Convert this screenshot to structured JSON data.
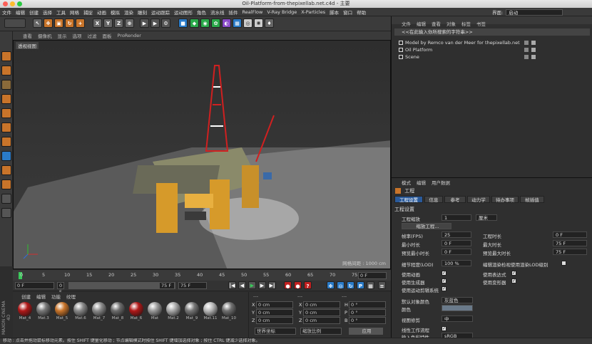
{
  "window": {
    "title": "Oil-Platform-from-thepixellab.net.c4d - 主要"
  },
  "menubar": {
    "items": [
      "文件",
      "编辑",
      "创建",
      "选择",
      "工具",
      "网格",
      "捕捉",
      "动画",
      "模拟",
      "渲染",
      "雕刻",
      "运动跟踪",
      "运动图形",
      "角色",
      "流水线",
      "插件",
      "RealFlow",
      "V-Ray Bridge",
      "X-Particles",
      "脚本",
      "窗口",
      "帮助"
    ],
    "layout_label": "界面:",
    "layout_value": "启动"
  },
  "viewport": {
    "menu": [
      "查看",
      "摄像机",
      "显示",
      "选项",
      "过滤",
      "面板",
      "ProRender"
    ],
    "label": "透视视图",
    "grid_info": "网格间距 : 1000 cm"
  },
  "timeline": {
    "ticks": [
      "0",
      "5",
      "10",
      "15",
      "20",
      "25",
      "30",
      "35",
      "40",
      "45",
      "50",
      "55",
      "60",
      "65",
      "70",
      "75"
    ],
    "frame_end_label": "0 F"
  },
  "playbar": {
    "start": "0 F",
    "current": "0 F",
    "end": "75 F",
    "max": "75 F"
  },
  "materials": {
    "menu": [
      "创建",
      "编辑",
      "功能",
      "纹理"
    ],
    "brand": "MAXON CINEMA 4D",
    "items": [
      {
        "name": "Mat_4",
        "color": "#b01818"
      },
      {
        "name": "Mat.3",
        "color": "#777777"
      },
      {
        "name": "Mat_5",
        "color": "#c8742a"
      },
      {
        "name": "Mat.6",
        "color": "#888888"
      },
      {
        "name": "Mat_7",
        "color": "#8a8a8a"
      },
      {
        "name": "Mat_8",
        "color": "#6c6c6c"
      },
      {
        "name": "Mat_6",
        "color": "#b01818"
      },
      {
        "name": "Mat",
        "color": "#999999"
      },
      {
        "name": "Mat.2",
        "color": "#a8a8a8"
      },
      {
        "name": "Mat_9",
        "color": "#777777"
      },
      {
        "name": "Mat.11",
        "color": "#b8b8b8"
      },
      {
        "name": "Mat_10",
        "color": "#707070"
      }
    ]
  },
  "coords": {
    "tabs": [
      "---",
      "---",
      "---"
    ],
    "rows": [
      {
        "a": "X",
        "av": "0 cm",
        "b": "X",
        "bv": "0 cm",
        "c": "H",
        "cv": "0 °"
      },
      {
        "a": "Y",
        "av": "0 cm",
        "b": "Y",
        "bv": "0 cm",
        "c": "P",
        "cv": "0 °"
      },
      {
        "a": "Z",
        "av": "0 cm",
        "b": "Z",
        "bv": "0 cm",
        "c": "B",
        "cv": "0 °"
      }
    ],
    "mode": "世界坐标",
    "scale": "缩放比例",
    "apply": "应用"
  },
  "objects": {
    "menu": [
      "文件",
      "编辑",
      "查看",
      "对象",
      "标签",
      "书签"
    ],
    "search": "<<在此输入你所搜索的字符串>>",
    "items": [
      "Model by Remco van der Meer for thepixellab.net",
      "Oil Platform",
      "Scene"
    ]
  },
  "attributes": {
    "menu": [
      "模式",
      "编辑",
      "用户数据"
    ],
    "title": "工程",
    "tabs": [
      "工程设置",
      "信息",
      "参考",
      "动力学",
      "待办事项",
      "帧插值"
    ],
    "section": "工程设置",
    "fields": {
      "scale_label": "工程缩放",
      "scale_value": "1",
      "scale_unit": "厘米",
      "scale_button": "缩放工程...",
      "fps_label": "帧率(FPS)",
      "fps_value": "25",
      "duration_label": "工程时长",
      "duration_value": "0 F",
      "min_label": "最小时长",
      "min_value": "0 F",
      "max_label": "最大时长",
      "max_value": "75 F",
      "pmin_label": "预览最小时长",
      "pmin_value": "0 F",
      "pmax_label": "预览最大时长",
      "pmax_value": "75 F",
      "lod_label": "细节程度(LOD)",
      "lod_value": "100 %",
      "lod_editor": "编辑渲染检视使用渲染LOD级别"
    },
    "checks": [
      "使用动画",
      "使用表达式",
      "使用生成器",
      "使用变形器",
      "使用运动剪辑系统"
    ],
    "default_color_label": "默认对象颜色",
    "default_color_value": "灰蓝色",
    "color_label": "颜色",
    "view_label": "视图修剪",
    "view_value": "中",
    "linear_label": "线性工作流程",
    "input_label": "输入色彩特性",
    "input_value": "sRGB"
  },
  "status": "移动 : 点击并拖动鼠标移动元素。按住 SHIFT 键量化移动 ; 节点编辑模式时按住 SHIFT 键增加选择对象 ; 按住 CTRL 键减少选择对象。"
}
